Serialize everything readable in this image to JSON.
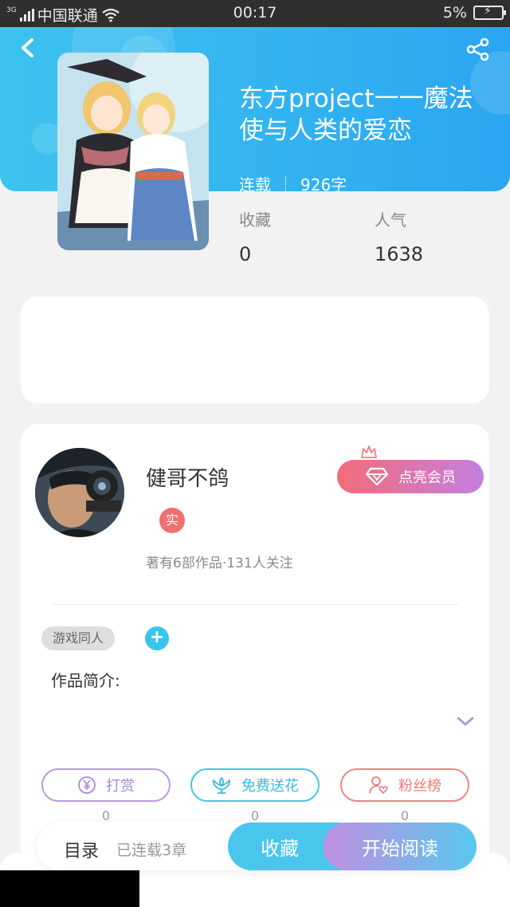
{
  "status_bar": {
    "network_label": "3G",
    "carrier": "中国联通",
    "time": "00:17",
    "battery": "5%"
  },
  "book": {
    "title": "东方project一一魔法使与人类的爱恋",
    "status": "连载",
    "word_count": "926字",
    "cover_icon": "book-cover-image"
  },
  "stats": {
    "favorites_label": "收藏",
    "favorites_value": "0",
    "popularity_label": "人气",
    "popularity_value": "1638"
  },
  "author": {
    "name": "健哥不鸽",
    "badge": "实",
    "summary": "著有6部作品·131人关注",
    "vip_label": "点亮会员"
  },
  "tags": {
    "items": [
      "游戏同人"
    ],
    "add_label": "+"
  },
  "intro": {
    "label": "作品简介:"
  },
  "actions": {
    "reward_label": "打赏",
    "reward_count": "0",
    "flower_label": "免费送花",
    "flower_count": "0",
    "fans_label": "粉丝榜",
    "fans_count": "0"
  },
  "bottom": {
    "toc_label": "目录",
    "chapters_label": "已连载3章",
    "collect_label": "收藏",
    "read_label": "开始阅读"
  },
  "colors": {
    "header_start": "#3dc3ef",
    "header_end": "#2aa6f2",
    "vip_start": "#f26c78",
    "vip_end": "#c47fe0",
    "accent": "#4ac6ee"
  }
}
